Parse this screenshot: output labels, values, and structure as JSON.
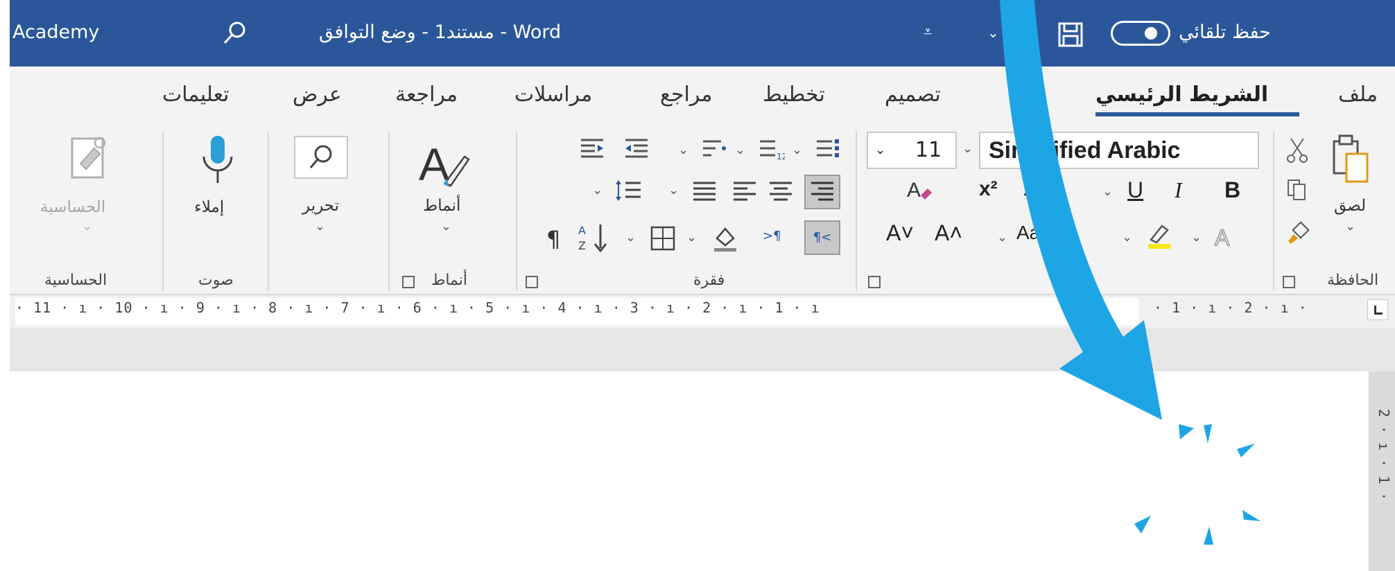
{
  "titlebar": {
    "autosave_label": "حفظ تلقائي",
    "doc_title": "مستند1 - وضع التوافق - Word",
    "account": "Academy"
  },
  "tabs": [
    "ملف",
    "الشريط الرئيسي",
    "تصميم",
    "تخطيط",
    "مراجع",
    "مراسلات",
    "مراجعة",
    "عرض",
    "تعليمات"
  ],
  "active_tab": "الشريط الرئيسي",
  "ribbon": {
    "clipboard": {
      "paste_label": "لصق",
      "group_label": "الحافظة"
    },
    "font": {
      "font_name": "Simplified Arabic",
      "font_size": "11",
      "bold": "B",
      "italic": "I",
      "underline": "U",
      "change_case": "Aa"
    },
    "paragraph": {
      "group_label": "فقرة",
      "pilcrow": "¶"
    },
    "styles": {
      "label": "أنماط",
      "group_label": "أنماط"
    },
    "editing": {
      "label": "تحرير"
    },
    "voice": {
      "dictate_label": "إملاء",
      "group_label": "صوت"
    },
    "sensitivity": {
      "label": "الحساسية",
      "group_label": "الحساسية"
    }
  },
  "ruler": {
    "left_marks": "· 11 · ı · 10 · ı · 9 · ı · 8 · ı · 7 · ı · 6 · ı · 5 · ı · 4 · ı · 3 · ı · 2 · ı · 1 · ı",
    "right_marks": "· 1 · ı · 2 · ı ·",
    "vertical_marks": "2 · ı · 1 ·"
  },
  "colors": {
    "title_bar": "#2b579a",
    "arrow": "#1ea5e6",
    "ribbon_bg": "#f3f3f3"
  }
}
